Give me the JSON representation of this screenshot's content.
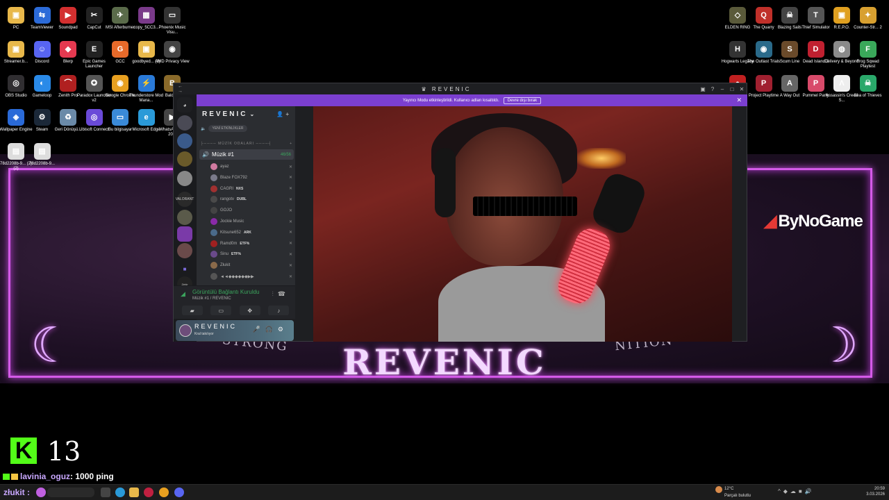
{
  "desktop_icons_left": [
    {
      "label": "PC",
      "color": "#e8b84a",
      "glyph": "▣"
    },
    {
      "label": "TeamViewer",
      "color": "#2c6bd8",
      "glyph": "⇆"
    },
    {
      "label": "Soundpad",
      "color": "#d32f2f",
      "glyph": "▶"
    },
    {
      "label": "CapCut",
      "color": "#222222",
      "glyph": "✂"
    },
    {
      "label": "MSI Afterburner",
      "color": "#5a6b4a",
      "glyph": "✈"
    },
    {
      "label": "copy_5CC3...",
      "color": "#7a3a8a",
      "glyph": "▦"
    },
    {
      "label": "Phoenix Music Visu...",
      "color": "#333333",
      "glyph": "▭"
    },
    {
      "label": "Streamer.b...",
      "color": "#e8b84a",
      "glyph": "▣"
    },
    {
      "label": "Discord",
      "color": "#5865f2",
      "glyph": "☺"
    },
    {
      "label": "Blerp",
      "color": "#e53950",
      "glyph": "◆"
    },
    {
      "label": "Epic Games Launcher",
      "color": "#222222",
      "glyph": "E"
    },
    {
      "label": "GCC",
      "color": "#e86a2a",
      "glyph": "G"
    },
    {
      "label": "goodbyed... (1)",
      "color": "#e8b84a",
      "glyph": "▣"
    },
    {
      "label": "AMD Privacy View",
      "color": "#444444",
      "glyph": "◉"
    },
    {
      "label": "OBS Studio",
      "color": "#302e31",
      "glyph": "◎"
    },
    {
      "label": "Gameloop",
      "color": "#2a8ae8",
      "glyph": "◐"
    },
    {
      "label": "Zenith Pro",
      "color": "#b02020",
      "glyph": "⌒"
    },
    {
      "label": "Paradox Launcher v2",
      "color": "#555555",
      "glyph": "✪"
    },
    {
      "label": "Google Chrome",
      "color": "#e8a020",
      "glyph": "◉"
    },
    {
      "label": "Thunderstore Mod Mana...",
      "color": "#2a7ad8",
      "glyph": "⚡"
    },
    {
      "label": "Baldurs",
      "color": "#8a6a2a",
      "glyph": "B"
    },
    {
      "label": "Wallpaper Engine",
      "color": "#2a6ad8",
      "glyph": "◈"
    },
    {
      "label": "Steam",
      "color": "#1b2838",
      "glyph": "⚙"
    },
    {
      "label": "Geri Dönüşü...",
      "color": "#6a8aa8",
      "glyph": "♻"
    },
    {
      "label": "Ubisoft Connect",
      "color": "#6a4ad8",
      "glyph": "◎"
    },
    {
      "label": "Bu bilgisayar",
      "color": "#3a8ad8",
      "glyph": "▭"
    },
    {
      "label": "Microsoft Edge",
      "color": "#2a9ad8",
      "glyph": "e"
    },
    {
      "label": "WhatsA Video 20...",
      "color": "#444444",
      "glyph": "▶"
    },
    {
      "label": "78d2208b-9... (2)(2)",
      "color": "#dddddd",
      "glyph": "▤"
    },
    {
      "label": "78d2208b-9...",
      "color": "#dddddd",
      "glyph": "▤"
    }
  ],
  "desktop_icons_right": [
    {
      "label": "ELDEN RING",
      "color": "#5a5a3a",
      "glyph": "◇"
    },
    {
      "label": "The Quarry",
      "color": "#c0302a",
      "glyph": "Q"
    },
    {
      "label": "Blazing Sails",
      "color": "#444444",
      "glyph": "☠"
    },
    {
      "label": "Thief Simulator",
      "color": "#555555",
      "glyph": "T"
    },
    {
      "label": "R.E.P.O.",
      "color": "#e0a020",
      "glyph": "▣"
    },
    {
      "label": "Counter-Str... 2",
      "color": "#d8a030",
      "glyph": "✦"
    },
    {
      "label": "Hogwarts Legacy",
      "color": "#333333",
      "glyph": "H"
    },
    {
      "label": "The Outlast Trials",
      "color": "#2a6a8a",
      "glyph": "◉"
    },
    {
      "label": "Scum Line",
      "color": "#6a4a2a",
      "glyph": "S"
    },
    {
      "label": "Dead Island 2",
      "color": "#c02030",
      "glyph": "D"
    },
    {
      "label": "Delivery & Beyond",
      "color": "#8a8a8a",
      "glyph": "◍"
    },
    {
      "label": "Frog Sqwad Playtest",
      "color": "#3aa85a",
      "glyph": "F"
    },
    {
      "label": "Feign",
      "color": "#c02020",
      "glyph": "●"
    },
    {
      "label": "Project Playtime",
      "color": "#a02030",
      "glyph": "P"
    },
    {
      "label": "A Way Out",
      "color": "#666666",
      "glyph": "A"
    },
    {
      "label": "Pummel Party",
      "color": "#d84a6a",
      "glyph": "P"
    },
    {
      "label": "Assassin's Creed S...",
      "color": "#eeeeee",
      "glyph": "Λ"
    },
    {
      "label": "Sea of Thieves",
      "color": "#2aa86a",
      "glyph": "☠"
    }
  ],
  "overlay": {
    "title": "REVENIC",
    "left_text": "STRONG",
    "right_text": "NITION",
    "sponsor": "ByNoGame",
    "corner_glyph": "☾"
  },
  "app": {
    "window_title": "♛ REVENIC",
    "nav": "← →",
    "banner_text": "Yayıncı Modu etkinleştirildi. Kullanıcı adları kısaltıldı.",
    "banner_button": "Devre dışı bırak",
    "server_name": "REVENIC",
    "new_events": "YENİ ETKİNLİKLER",
    "category": "├──── MÜZİK ODALARI ────┤",
    "voice_channel": "Müzik #1",
    "voice_count": "46/56",
    "voice_users": [
      {
        "name": "ayaz",
        "tag": "",
        "color": "#d07aa0"
      },
      {
        "name": "Blaze FOX792",
        "tag": "",
        "color": "#7a7a8a"
      },
      {
        "name": "CAGRI",
        "tag": "NXS",
        "color": "#a03030"
      },
      {
        "name": "rangotv",
        "tag": "DUBL",
        "color": "#4a4a4a"
      },
      {
        "name": "GOJO",
        "tag": "",
        "color": "#444444"
      },
      {
        "name": "Jockie Music",
        "tag": "",
        "color": "#8a2aa8"
      },
      {
        "name": "Kitsune652",
        "tag": "ARK",
        "color": "#4a6a8a"
      },
      {
        "name": "Ramd0m",
        "tag": "ETF%",
        "color": "#a02020"
      },
      {
        "name": "Sinu",
        "tag": "ETF%",
        "color": "#6a4a8a"
      },
      {
        "name": "Złukit",
        "tag": "",
        "color": "#8a6a4a"
      },
      {
        "name": "◄◄◆◆◆◆◆◆▶▶",
        "tag": "",
        "color": "#555555"
      }
    ],
    "voice_status": "Görüntülü Bağlantı Kuruldu",
    "voice_status_channel": "Müzik #1 / REVENIC",
    "user_name": "REVENIC",
    "user_status": "Kral takılıyor"
  },
  "stream": {
    "viewers": "13",
    "chat_user": "lavinia_oguz",
    "chat_message": ": 1000 ping"
  },
  "taskbar": {
    "user": "złukit :",
    "weather_temp": "12°C",
    "weather_desc": "Parçalı bulutlu",
    "time": "20:59",
    "date": "3.03.2026"
  }
}
